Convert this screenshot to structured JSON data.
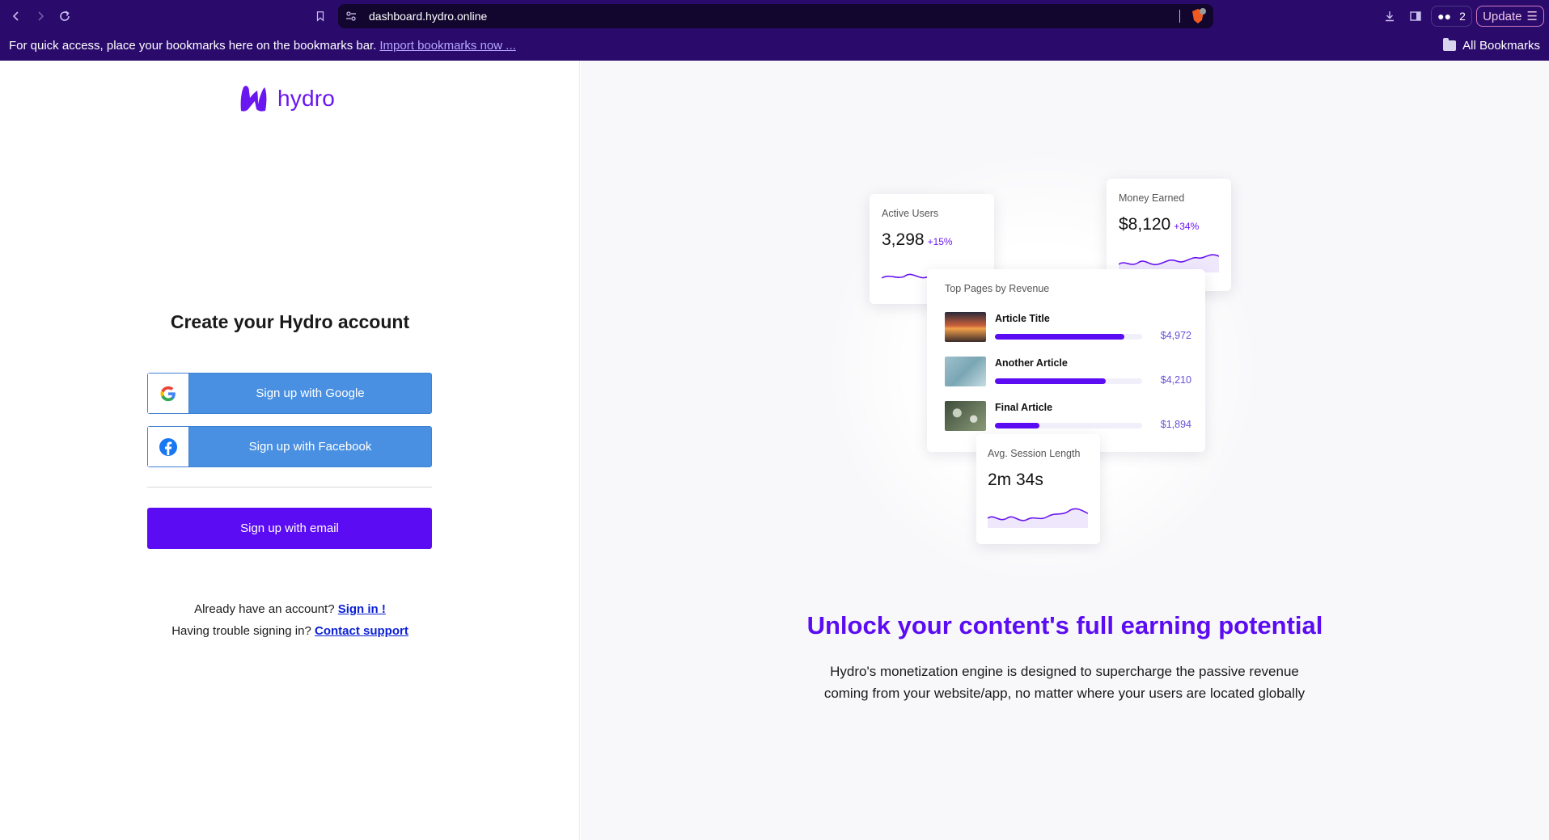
{
  "browser": {
    "url": "dashboard.hydro.online",
    "extensions_count": "2",
    "update_label": "Update",
    "bookmarks_hint": "For quick access, place your bookmarks here on the bookmarks bar.",
    "import_bookmarks": "Import bookmarks now ...",
    "all_bookmarks": "All Bookmarks"
  },
  "brand": {
    "name": "hydro",
    "color": "#6a16f0"
  },
  "signup": {
    "title": "Create your Hydro account",
    "google_label": "Sign up with Google",
    "facebook_label": "Sign up with Facebook",
    "email_label": "Sign up with email",
    "have_account": "Already have an account?",
    "sign_in": "Sign in !",
    "trouble": "Having trouble signing in?",
    "contact_support": "Contact support"
  },
  "dashboard": {
    "active_users": {
      "label": "Active Users",
      "value": "3,298",
      "delta": "+15%"
    },
    "money_earned": {
      "label": "Money Earned",
      "value": "$8,120",
      "delta": "+34%"
    },
    "top_pages": {
      "label": "Top Pages by Revenue",
      "items": [
        {
          "title": "Article Title",
          "amount": "$4,972",
          "share": 0.88
        },
        {
          "title": "Another Article",
          "amount": "$4,210",
          "share": 0.75
        },
        {
          "title": "Final Article",
          "amount": "$1,894",
          "share": 0.3
        }
      ]
    },
    "session": {
      "label": "Avg. Session Length",
      "value": "2m 34s"
    }
  },
  "promo": {
    "headline": "Unlock your content's full earning potential",
    "body": "Hydro's monetization engine is designed to supercharge the passive revenue coming from your website/app, no matter where your users are located globally"
  },
  "colors": {
    "accent": "#5b0cf2",
    "social_blue": "#4a90e2",
    "chrome": "#2a0b6b"
  }
}
